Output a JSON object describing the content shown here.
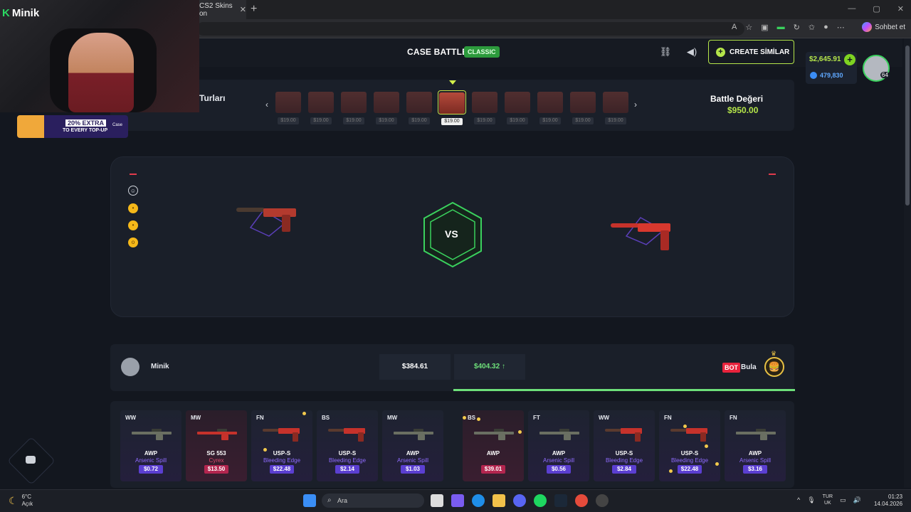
{
  "browser": {
    "tab_title": "CS2 Skins on",
    "tab_close": "✕",
    "new_tab": "+",
    "window_controls": [
      "—",
      "▢",
      "✕"
    ],
    "copilot_label": "Sohbet et"
  },
  "header": {
    "title": "CASE BATTLE",
    "mode_badge": "CLASSIC",
    "create_label": "CREATE SİMİLAR"
  },
  "account": {
    "balance": "$2,645.91",
    "gems": "479,830",
    "level": "64"
  },
  "rounds": {
    "label": "Turları",
    "cases": [
      {
        "price": "$19.00",
        "active": false
      },
      {
        "price": "$19.00",
        "active": false
      },
      {
        "price": "$19.00",
        "active": false
      },
      {
        "price": "$19.00",
        "active": false
      },
      {
        "price": "$19.00",
        "active": false
      },
      {
        "price": "$19.00",
        "active": true
      },
      {
        "price": "$19.00",
        "active": false
      },
      {
        "price": "$19.00",
        "active": false
      },
      {
        "price": "$19.00",
        "active": false
      },
      {
        "price": "$19.00",
        "active": false
      },
      {
        "price": "$19.00",
        "active": false
      }
    ],
    "battle_label": "Battle Değeri",
    "battle_value": "$950.00"
  },
  "arena": {
    "vs": "VS"
  },
  "players": {
    "left": {
      "name": "Minik",
      "total": "$384.61"
    },
    "right": {
      "badge": "BOT",
      "name": "Bula",
      "total": "$404.32 ↑"
    }
  },
  "drops": [
    {
      "wear": "WW",
      "weapon": "AWP",
      "skin": "Arsenic Spill",
      "price": "$0.72",
      "style": "purple"
    },
    {
      "wear": "MW",
      "weapon": "SG 553",
      "skin": "Cyrex",
      "price": "$13.50",
      "style": "red"
    },
    {
      "wear": "FN",
      "weapon": "USP-S",
      "skin": "Bleeding Edge",
      "price": "$22.48",
      "style": "purple"
    },
    {
      "wear": "BS",
      "weapon": "USP-S",
      "skin": "Bleeding Edge",
      "price": "$2.14",
      "style": "purple"
    },
    {
      "wear": "MW",
      "weapon": "AWP",
      "skin": "Arsenic Spill",
      "price": "$1.03",
      "style": "purple"
    },
    {
      "wear": "BS",
      "weapon": "AWP",
      "skin": "",
      "price": "$39.01",
      "style": "red"
    },
    {
      "wear": "FT",
      "weapon": "AWP",
      "skin": "Arsenic Spill",
      "price": "$0.56",
      "style": "purple"
    },
    {
      "wear": "WW",
      "weapon": "USP-S",
      "skin": "Bleeding Edge",
      "price": "$2.84",
      "style": "purple"
    },
    {
      "wear": "FN",
      "weapon": "USP-S",
      "skin": "Bleeding Edge",
      "price": "$22.48",
      "style": "purple"
    },
    {
      "wear": "FN",
      "weapon": "AWP",
      "skin": "Arsenic Spill",
      "price": "$3.16",
      "style": "purple"
    }
  ],
  "overlay": {
    "streamer": "Minik",
    "promo_line1": "20% EXTRA",
    "promo_line2": "TO EVERY TOP-UP",
    "promo_logo": "Case"
  },
  "taskbar": {
    "temp": "6°C",
    "weather": "Açık",
    "search": "Ara",
    "lang_top": "TUR",
    "lang_bottom": "UK",
    "time": "01:23",
    "date": "14.04.2026"
  }
}
